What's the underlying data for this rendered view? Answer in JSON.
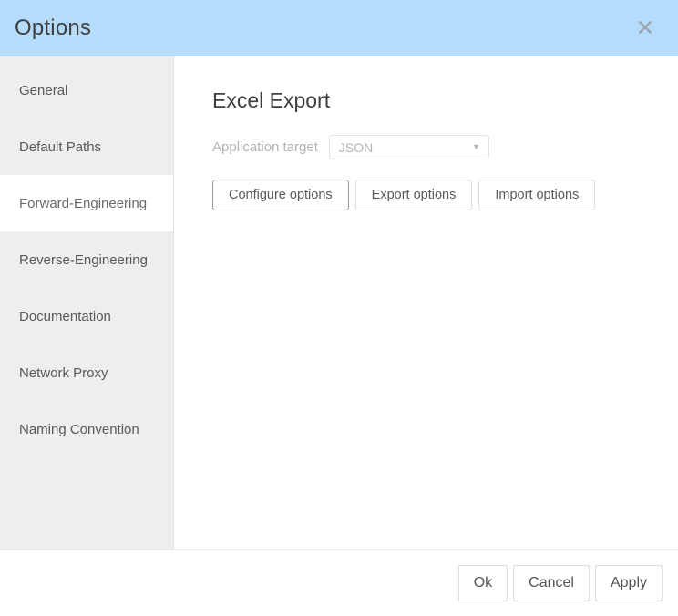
{
  "window": {
    "title": "Options",
    "close_icon": "close-icon",
    "header_color": "#b6dcfb"
  },
  "sidebar": {
    "items": [
      {
        "label": "General",
        "selected": false
      },
      {
        "label": "Default Paths",
        "selected": false
      },
      {
        "label": "Forward-Engineering",
        "selected": true
      },
      {
        "label": "Reverse-Engineering",
        "selected": false
      },
      {
        "label": "Documentation",
        "selected": false
      },
      {
        "label": "Network Proxy",
        "selected": false
      },
      {
        "label": "Naming Convention",
        "selected": false
      }
    ]
  },
  "content": {
    "title": "Excel Export",
    "application_target": {
      "label": "Application target",
      "value": "JSON",
      "caret_icon": "chevron-down-icon"
    },
    "buttons": [
      {
        "label": "Configure options",
        "focused": true
      },
      {
        "label": "Export options",
        "focused": false
      },
      {
        "label": "Import options",
        "focused": false
      }
    ]
  },
  "footer": {
    "ok_label": "Ok",
    "cancel_label": "Cancel",
    "apply_label": "Apply"
  }
}
